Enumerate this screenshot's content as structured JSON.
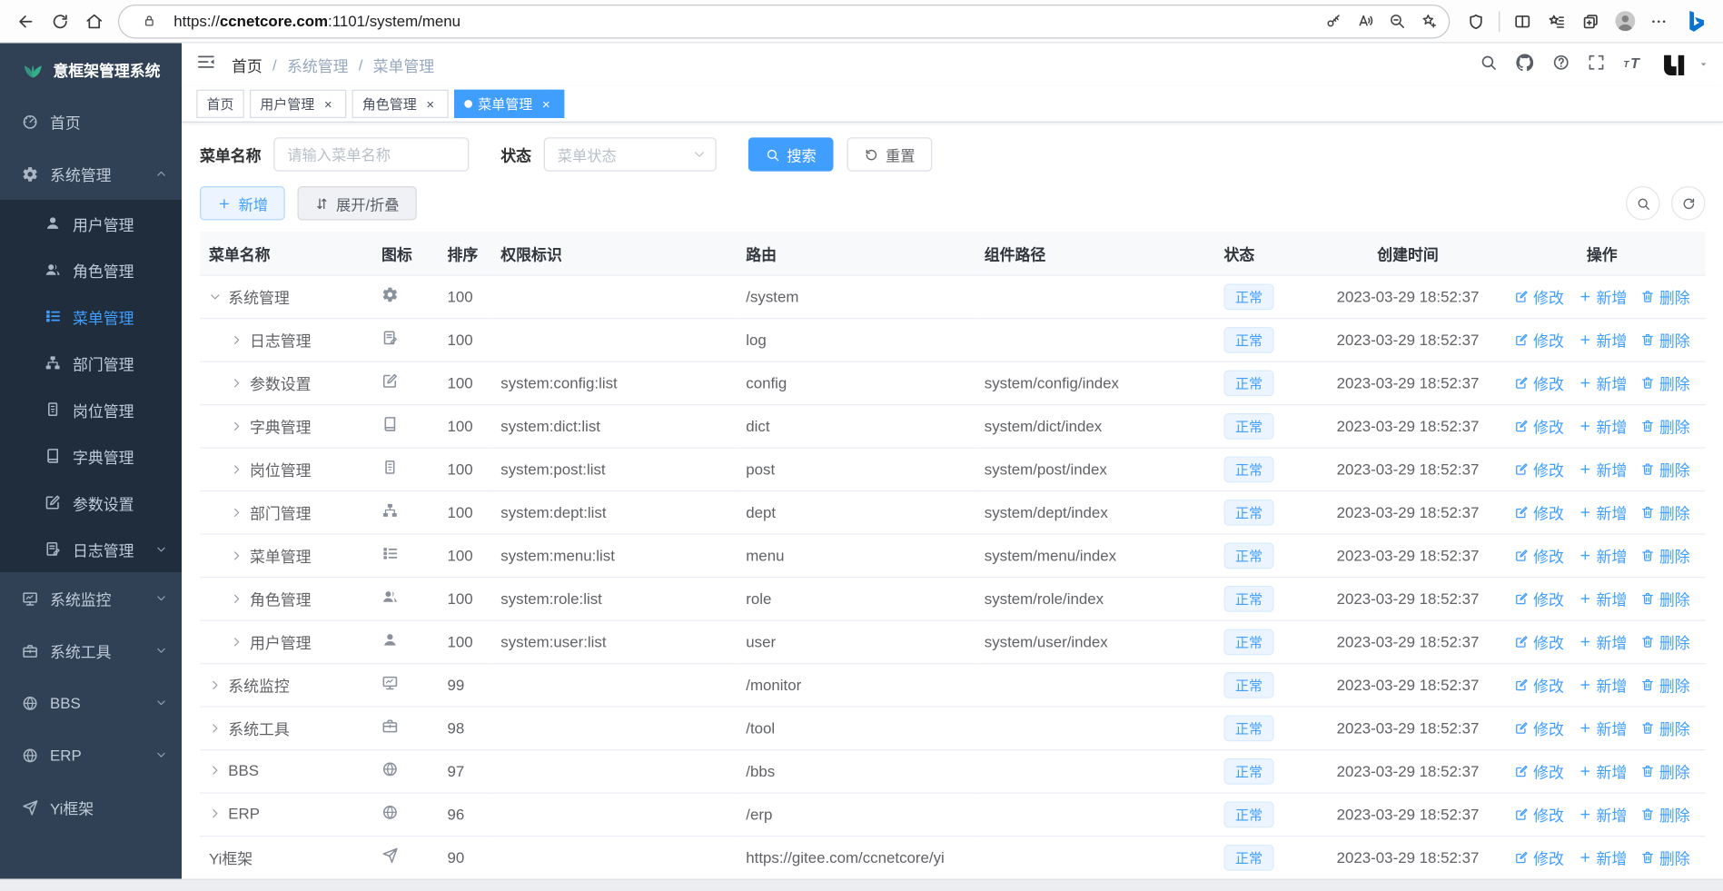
{
  "browser": {
    "url_scheme": "https://",
    "url_host": "ccnetcore.com",
    "url_path": ":1101/system/menu",
    "nav_icons": [
      "back-icon",
      "reload-icon",
      "home-icon"
    ],
    "url_icons": [
      "lock-icon",
      "key-icon",
      "read-aloud-icon",
      "zoom-out-icon",
      "favorite-add-icon"
    ],
    "toolbar_icons": [
      "browser-essentials-icon",
      "split-screen-icon",
      "favorites-bar-icon",
      "collections-icon",
      "profile-avatar",
      "more-icon",
      "bing-icon"
    ]
  },
  "app": {
    "title": "意框架管理系统",
    "sidebar": {
      "items": [
        {
          "label": "首页",
          "icon": "dashboard-icon"
        },
        {
          "label": "系统管理",
          "icon": "gear-icon",
          "arrow": "up",
          "open": true,
          "children": [
            {
              "label": "用户管理",
              "icon": "user-icon"
            },
            {
              "label": "角色管理",
              "icon": "users-icon"
            },
            {
              "label": "菜单管理",
              "icon": "menu-tree-icon",
              "active": true
            },
            {
              "label": "部门管理",
              "icon": "org-tree-icon"
            },
            {
              "label": "岗位管理",
              "icon": "badge-icon"
            },
            {
              "label": "字典管理",
              "icon": "book-icon"
            },
            {
              "label": "参数设置",
              "icon": "edit-icon"
            },
            {
              "label": "日志管理",
              "icon": "log-icon",
              "arrow": "down"
            }
          ]
        },
        {
          "label": "系统监控",
          "icon": "monitor-icon",
          "arrow": "down"
        },
        {
          "label": "系统工具",
          "icon": "toolbox-icon",
          "arrow": "down"
        },
        {
          "label": "BBS",
          "icon": "globe-icon",
          "arrow": "down"
        },
        {
          "label": "ERP",
          "icon": "globe-icon",
          "arrow": "down"
        },
        {
          "label": "Yi框架",
          "icon": "send-icon"
        }
      ]
    },
    "header": {
      "breadcrumb": [
        "首页",
        "系统管理",
        "菜单管理"
      ],
      "separator": "/",
      "right_icons": [
        "search-icon",
        "github-icon",
        "question-icon",
        "fullscreen-icon",
        "text-size-icon",
        "yi-logo-avatar",
        "caret-down-icon"
      ]
    },
    "tabs": [
      {
        "label": "首页",
        "closable": false,
        "active": false
      },
      {
        "label": "用户管理",
        "closable": true,
        "active": false
      },
      {
        "label": "角色管理",
        "closable": true,
        "active": false
      },
      {
        "label": "菜单管理",
        "closable": true,
        "active": true
      }
    ],
    "search": {
      "name_label": "菜单名称",
      "name_placeholder": "请输入菜单名称",
      "name_value": "",
      "status_label": "状态",
      "status_placeholder": "菜单状态",
      "search_button": "搜索",
      "reset_button": "重置"
    },
    "toolbar": {
      "add_button": "新增",
      "toggle_button": "展开/折叠",
      "right_icons": [
        "search-circle-icon",
        "refresh-circle-icon"
      ]
    },
    "table": {
      "headers": [
        "菜单名称",
        "图标",
        "排序",
        "权限标识",
        "路由",
        "组件路径",
        "状态",
        "创建时间",
        "操作"
      ],
      "action_labels": {
        "edit": "修改",
        "add": "新增",
        "delete": "删除"
      },
      "rows": [
        {
          "name": "系统管理",
          "icon": "gear-icon",
          "expand": "down",
          "level": 0,
          "order": "100",
          "perms": "",
          "route": "/system",
          "component": "",
          "status": "正常",
          "created": "2023-03-29 18:52:37"
        },
        {
          "name": "日志管理",
          "icon": "log-icon",
          "expand": "right",
          "level": 1,
          "order": "100",
          "perms": "",
          "route": "log",
          "component": "",
          "status": "正常",
          "created": "2023-03-29 18:52:37"
        },
        {
          "name": "参数设置",
          "icon": "edit-icon",
          "expand": "right",
          "level": 1,
          "order": "100",
          "perms": "system:config:list",
          "route": "config",
          "component": "system/config/index",
          "status": "正常",
          "created": "2023-03-29 18:52:37"
        },
        {
          "name": "字典管理",
          "icon": "book-icon",
          "expand": "right",
          "level": 1,
          "order": "100",
          "perms": "system:dict:list",
          "route": "dict",
          "component": "system/dict/index",
          "status": "正常",
          "created": "2023-03-29 18:52:37"
        },
        {
          "name": "岗位管理",
          "icon": "badge-icon",
          "expand": "right",
          "level": 1,
          "order": "100",
          "perms": "system:post:list",
          "route": "post",
          "component": "system/post/index",
          "status": "正常",
          "created": "2023-03-29 18:52:37"
        },
        {
          "name": "部门管理",
          "icon": "org-tree-icon",
          "expand": "right",
          "level": 1,
          "order": "100",
          "perms": "system:dept:list",
          "route": "dept",
          "component": "system/dept/index",
          "status": "正常",
          "created": "2023-03-29 18:52:37"
        },
        {
          "name": "菜单管理",
          "icon": "menu-tree-icon",
          "expand": "right",
          "level": 1,
          "order": "100",
          "perms": "system:menu:list",
          "route": "menu",
          "component": "system/menu/index",
          "status": "正常",
          "created": "2023-03-29 18:52:37"
        },
        {
          "name": "角色管理",
          "icon": "users-icon",
          "expand": "right",
          "level": 1,
          "order": "100",
          "perms": "system:role:list",
          "route": "role",
          "component": "system/role/index",
          "status": "正常",
          "created": "2023-03-29 18:52:37"
        },
        {
          "name": "用户管理",
          "icon": "user-icon",
          "expand": "right",
          "level": 1,
          "order": "100",
          "perms": "system:user:list",
          "route": "user",
          "component": "system/user/index",
          "status": "正常",
          "created": "2023-03-29 18:52:37"
        },
        {
          "name": "系统监控",
          "icon": "monitor-icon",
          "expand": "right",
          "level": 0,
          "order": "99",
          "perms": "",
          "route": "/monitor",
          "component": "",
          "status": "正常",
          "created": "2023-03-29 18:52:37"
        },
        {
          "name": "系统工具",
          "icon": "toolbox-icon",
          "expand": "right",
          "level": 0,
          "order": "98",
          "perms": "",
          "route": "/tool",
          "component": "",
          "status": "正常",
          "created": "2023-03-29 18:52:37"
        },
        {
          "name": "BBS",
          "icon": "globe-icon",
          "expand": "right",
          "level": 0,
          "order": "97",
          "perms": "",
          "route": "/bbs",
          "component": "",
          "status": "正常",
          "created": "2023-03-29 18:52:37"
        },
        {
          "name": "ERP",
          "icon": "globe-icon",
          "expand": "right",
          "level": 0,
          "order": "96",
          "perms": "",
          "route": "/erp",
          "component": "",
          "status": "正常",
          "created": "2023-03-29 18:52:37"
        },
        {
          "name": "Yi框架",
          "icon": "send-icon",
          "expand": "none",
          "level": 0,
          "order": "90",
          "perms": "",
          "route": "https://gitee.com/ccnetcore/yi",
          "component": "",
          "status": "正常",
          "created": "2023-03-29 18:52:37"
        }
      ]
    }
  },
  "colors": {
    "accent": "#409eff",
    "sidebar_bg": "#304156",
    "submenu_bg": "#1f2d3d",
    "sidebar_text": "#bfcbd9",
    "badge_bg": "#ecf5ff",
    "badge_border": "#d9ecff",
    "logo_green": "#35b08b",
    "tag_active_bg": "#409eff"
  }
}
